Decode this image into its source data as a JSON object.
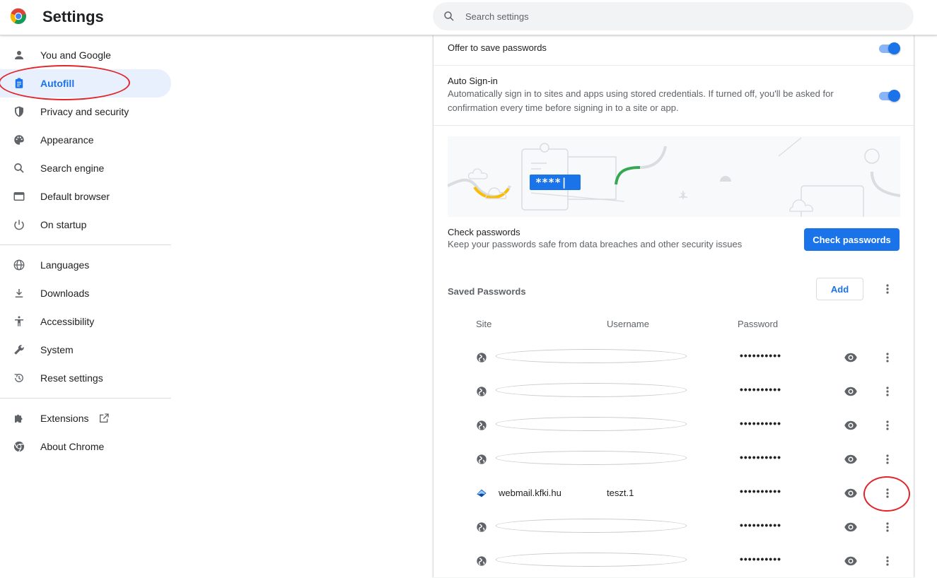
{
  "header": {
    "title": "Settings",
    "search_placeholder": "Search settings"
  },
  "sidebar": {
    "items": [
      {
        "label": "You and Google",
        "icon": "person-icon"
      },
      {
        "label": "Autofill",
        "icon": "clipboard-icon",
        "active": true
      },
      {
        "label": "Privacy and security",
        "icon": "shield-icon"
      },
      {
        "label": "Appearance",
        "icon": "palette-icon"
      },
      {
        "label": "Search engine",
        "icon": "search-icon"
      },
      {
        "label": "Default browser",
        "icon": "browser-window-icon"
      },
      {
        "label": "On startup",
        "icon": "power-icon"
      }
    ],
    "items2": [
      {
        "label": "Languages",
        "icon": "globe-icon"
      },
      {
        "label": "Downloads",
        "icon": "download-icon"
      },
      {
        "label": "Accessibility",
        "icon": "accessibility-icon"
      },
      {
        "label": "System",
        "icon": "wrench-icon"
      },
      {
        "label": "Reset settings",
        "icon": "history-icon"
      }
    ],
    "items3": [
      {
        "label": "Extensions",
        "icon": "puzzle-icon"
      },
      {
        "label": "About Chrome",
        "icon": "chrome-icon"
      }
    ]
  },
  "main": {
    "offer_to_save": "Offer to save passwords",
    "auto_signin_title": "Auto Sign-in",
    "auto_signin_desc": "Automatically sign in to sites and apps using stored credentials. If turned off, you'll be asked for confirmation every time before signing in to a site or app.",
    "banner_password_text": "****|",
    "check_title": "Check passwords",
    "check_desc": "Keep your passwords safe from data breaches and other security issues",
    "check_button": "Check passwords",
    "saved_title": "Saved Passwords",
    "add_button": "Add",
    "columns": {
      "site": "Site",
      "username": "Username",
      "password": "Password"
    },
    "rows": [
      {
        "site": "",
        "username": "",
        "password": "••••••••••",
        "redacted": true
      },
      {
        "site": "",
        "username": "",
        "password": "••••••••••",
        "redacted": true
      },
      {
        "site": "",
        "username": "",
        "password": "••••••••••",
        "redacted": true
      },
      {
        "site": "",
        "username": "",
        "password": "••••••••••",
        "redacted": true
      },
      {
        "site": "webmail.kfki.hu",
        "username": "teszt.1",
        "password": "••••••••••",
        "redacted": false
      },
      {
        "site": "",
        "username": "",
        "password": "••••••••••",
        "redacted": true
      },
      {
        "site": "",
        "username": "",
        "password": "••••••••••",
        "redacted": true
      }
    ]
  },
  "colors": {
    "accent": "#1a73e8",
    "active_bg": "#e8f0fe",
    "annotation": "#e0262b"
  }
}
